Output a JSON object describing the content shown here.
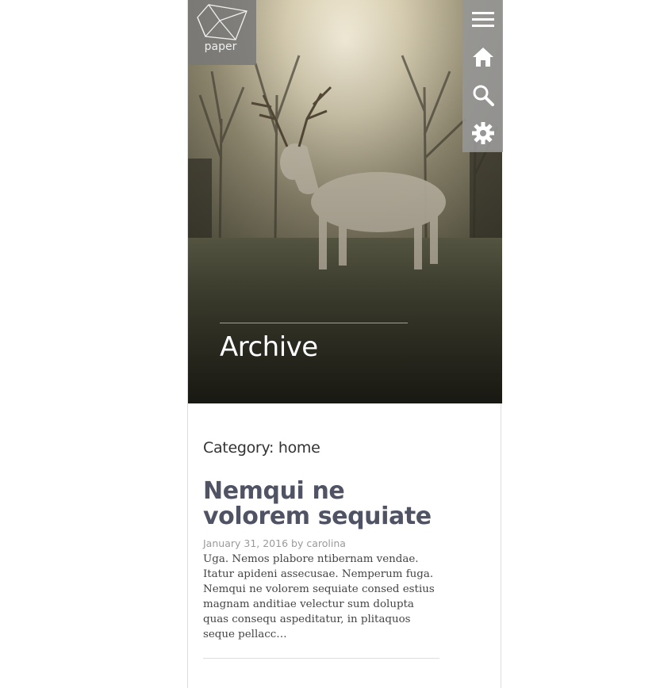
{
  "logo": {
    "text": "paper",
    "icon": "paper-logo-icon"
  },
  "sidebar": {
    "items": [
      {
        "name": "menu",
        "icon": "hamburger-menu-icon"
      },
      {
        "name": "home",
        "icon": "home-icon"
      },
      {
        "name": "search",
        "icon": "search-icon"
      },
      {
        "name": "settings",
        "icon": "gear-icon"
      }
    ]
  },
  "hero": {
    "title": "Archive"
  },
  "category": {
    "label": "Category:",
    "value": "home"
  },
  "post": {
    "title": "Nemqui ne volorem sequiate",
    "date": "January 31, 2016",
    "by": "by",
    "author": "carolina",
    "excerpt": "Uga. Nemos plabore ntibernam vendae. Itatur apideni assecusae. Nemperum fuga. Nemqui ne volorem sequiate consed estius magnam anditiae velectur sum dolupta quas consequ aspeditatur, in plitaquos seque pellacc…"
  },
  "colors": {
    "sidebar_bg": "#969696",
    "title_color": "#4f5364",
    "meta_color": "#9a9a9a"
  }
}
